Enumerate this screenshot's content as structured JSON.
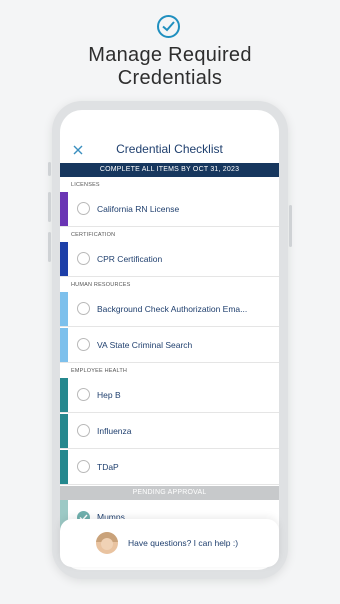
{
  "headline": {
    "line1": "Manage Required",
    "line2": "Credentials"
  },
  "header": {
    "title": "Credential Checklist"
  },
  "banner": "COMPLETE ALL ITEMS BY OCT 31, 2023",
  "sections": [
    {
      "title": "LICENSES",
      "color": "#6a35b4",
      "items": [
        "California RN License"
      ]
    },
    {
      "title": "CERTIFICATION",
      "color": "#1d3fa8",
      "items": [
        "CPR Certification"
      ]
    },
    {
      "title": "HUMAN RESOURCES",
      "color": "#7dc0ec",
      "items": [
        "Background Check Authorization Ema...",
        "VA State Criminal Search"
      ]
    },
    {
      "title": "EMPLOYEE HEALTH",
      "color": "#25888e",
      "items": [
        "Hep B",
        "Influenza",
        "TDaP"
      ]
    }
  ],
  "pending": {
    "title": "PENDING APPROVAL",
    "color": "#9cc9c5",
    "items": [
      "Mumps"
    ]
  },
  "help": {
    "text": "Have questions? I can help :)"
  },
  "icons": {
    "top": "check-circle-icon",
    "close": "close-icon",
    "avatar": "avatar"
  }
}
